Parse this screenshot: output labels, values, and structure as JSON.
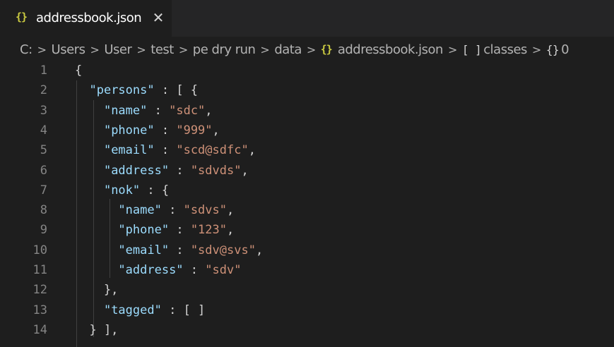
{
  "tab": {
    "icon": "{}",
    "icon_name": "json-braces-icon",
    "title": "addressbook.json",
    "close_glyph": "✕"
  },
  "breadcrumb": {
    "items": [
      {
        "label": "C:",
        "icon": ""
      },
      {
        "label": "Users",
        "icon": ""
      },
      {
        "label": "User",
        "icon": ""
      },
      {
        "label": "test",
        "icon": ""
      },
      {
        "label": "pe dry run",
        "icon": ""
      },
      {
        "label": "data",
        "icon": ""
      },
      {
        "label": "addressbook.json",
        "icon": "{}"
      },
      {
        "label": "classes",
        "icon": "[ ]"
      },
      {
        "label": "0",
        "icon": "{}"
      }
    ],
    "separator": ">"
  },
  "editor": {
    "lines": [
      {
        "num": "1",
        "text": "{"
      },
      {
        "num": "2",
        "text": "  \"persons\" : [ {"
      },
      {
        "num": "3",
        "text": "    \"name\" : \"sdc\","
      },
      {
        "num": "4",
        "text": "    \"phone\" : \"999\","
      },
      {
        "num": "5",
        "text": "    \"email\" : \"scd@sdfc\","
      },
      {
        "num": "6",
        "text": "    \"address\" : \"sdvds\","
      },
      {
        "num": "7",
        "text": "    \"nok\" : {"
      },
      {
        "num": "8",
        "text": "      \"name\" : \"sdvs\","
      },
      {
        "num": "9",
        "text": "      \"phone\" : \"123\","
      },
      {
        "num": "10",
        "text": "      \"email\" : \"sdv@svs\","
      },
      {
        "num": "11",
        "text": "      \"address\" : \"sdv\""
      },
      {
        "num": "12",
        "text": "    },"
      },
      {
        "num": "13",
        "text": "    \"tagged\" : [ ]"
      },
      {
        "num": "14",
        "text": "  } ],"
      }
    ]
  },
  "colors": {
    "background": "#1e1e1e",
    "tabbar": "#252526",
    "json_icon": "#cbcb41",
    "key": "#9cdcfe",
    "string": "#ce9178",
    "punctuation": "#d4d4d4",
    "line_number": "#858585"
  }
}
